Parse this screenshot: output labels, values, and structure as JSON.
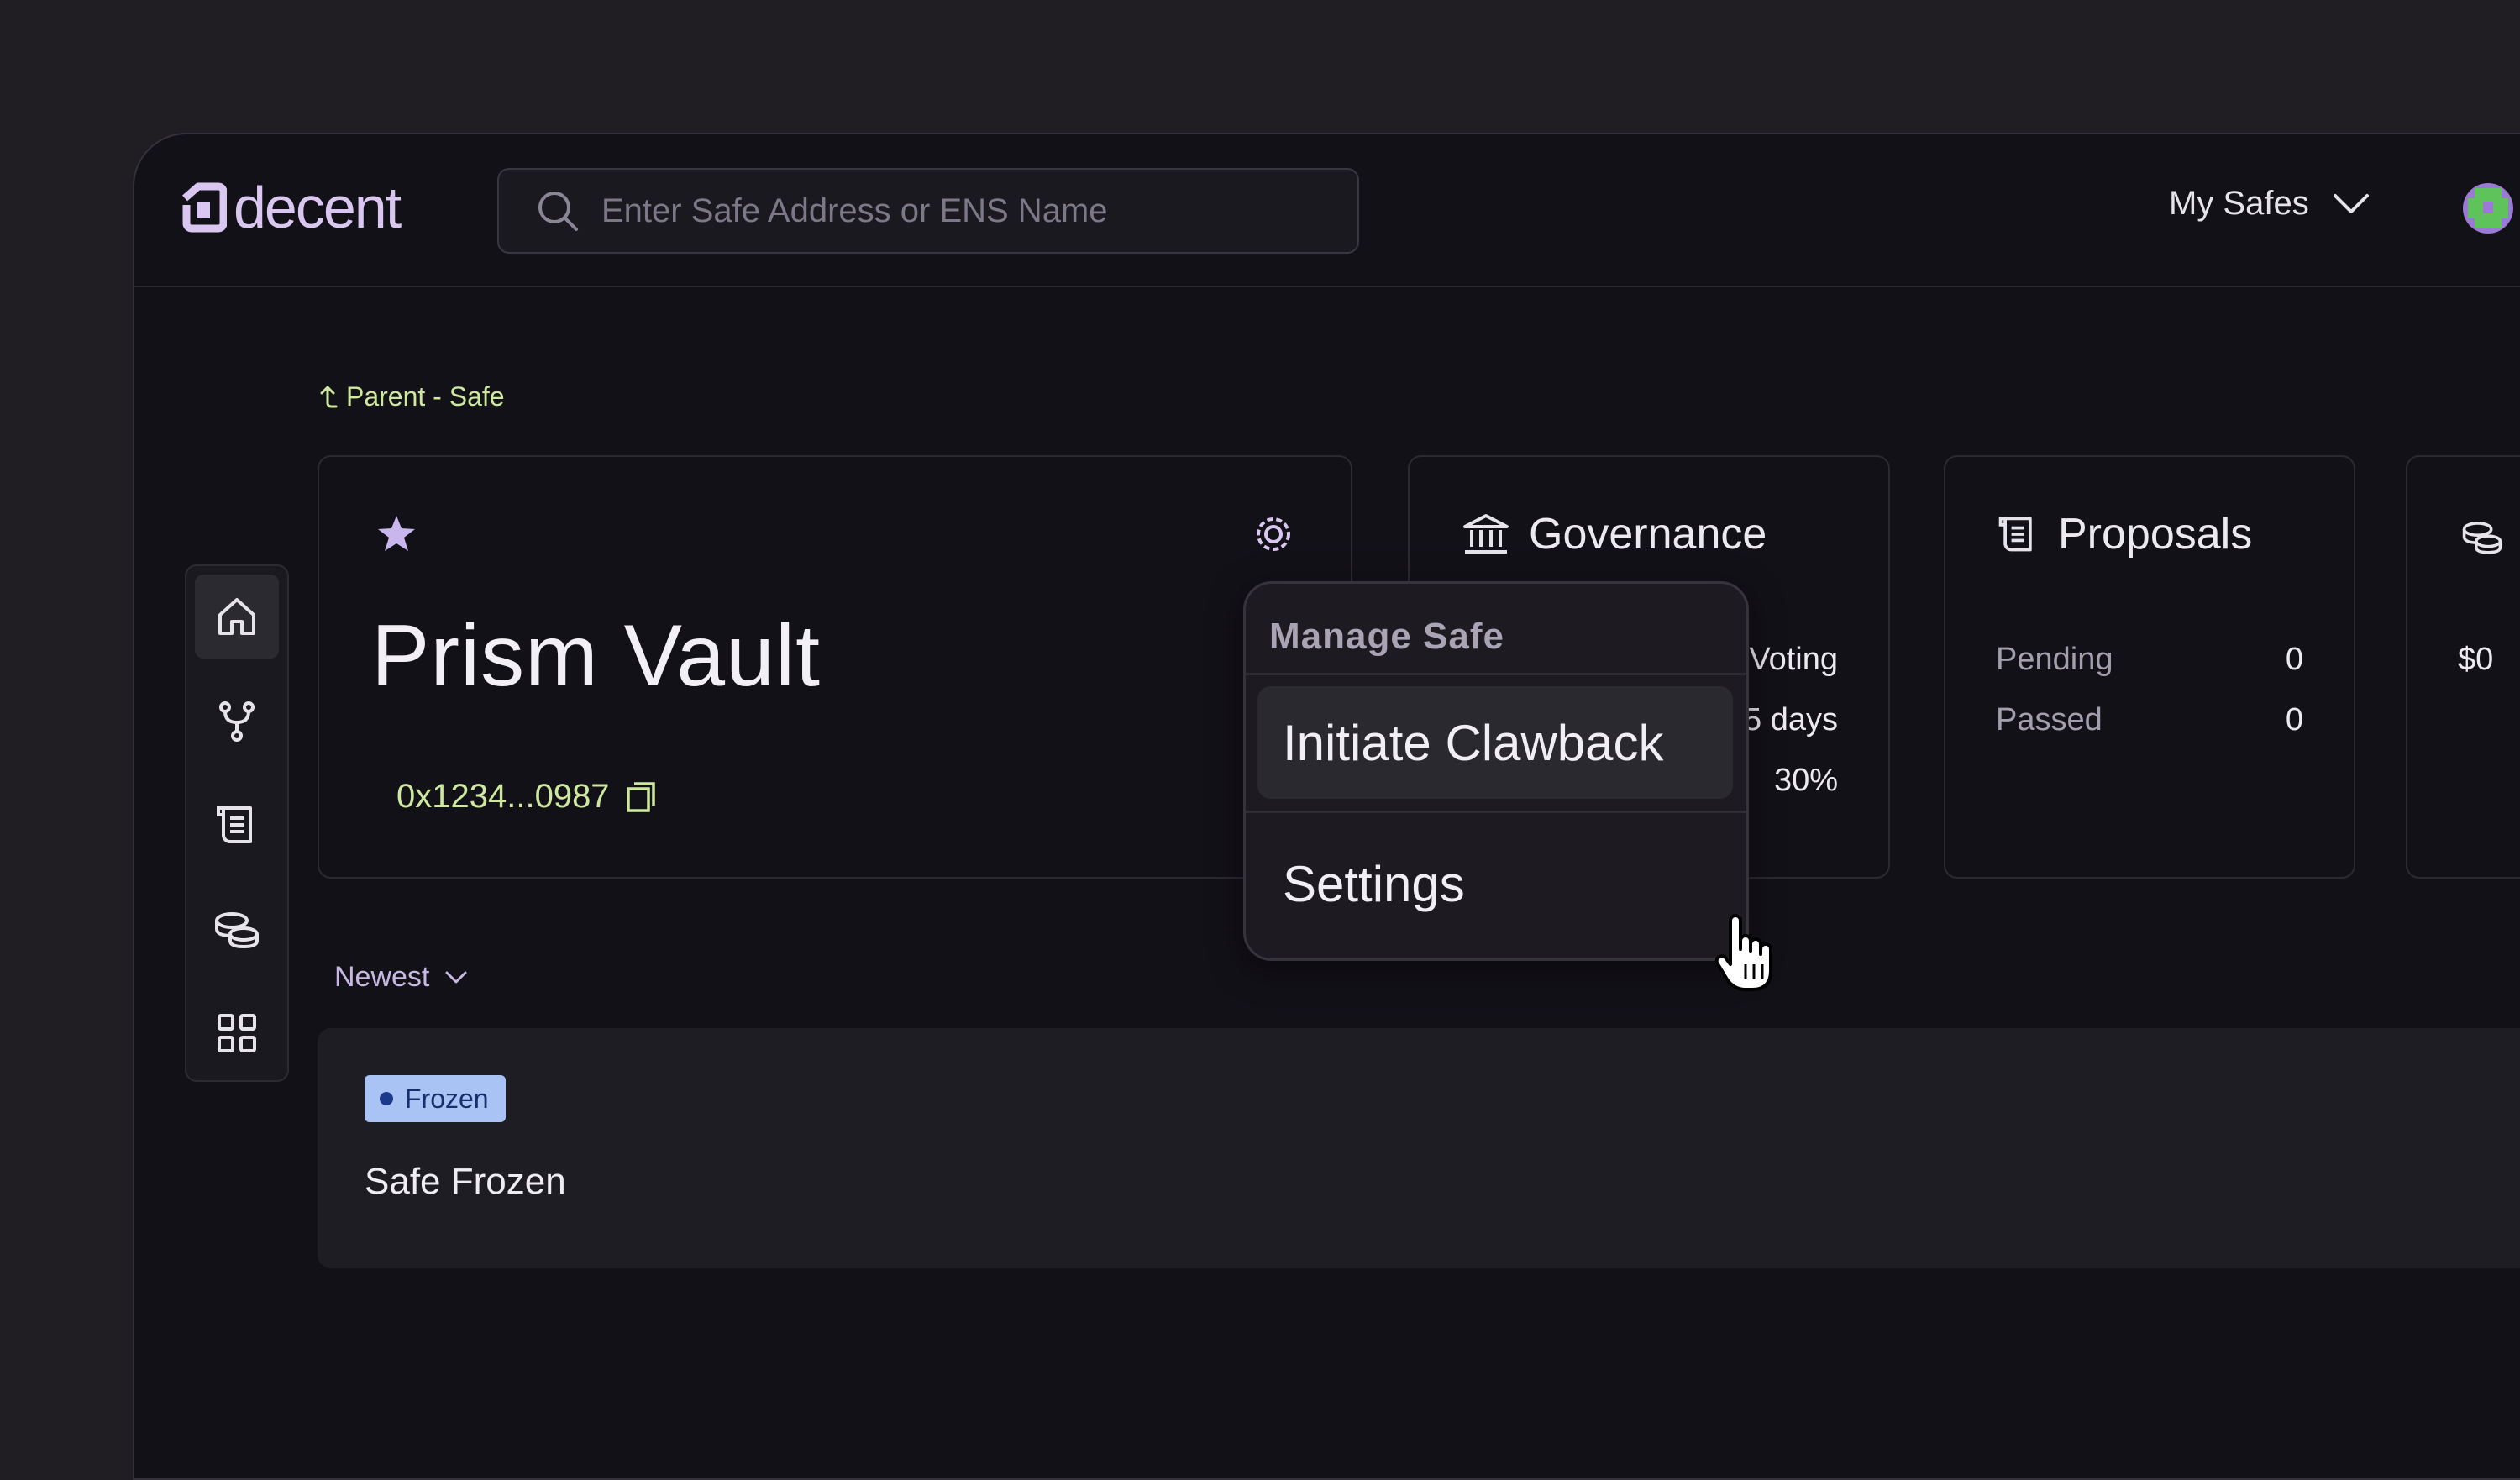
{
  "brand": {
    "name": "decent"
  },
  "search": {
    "placeholder": "Enter Safe Address or ENS Name"
  },
  "header": {
    "my_safes_label": "My Safes"
  },
  "breadcrumb": {
    "label": "Parent - Safe"
  },
  "sidebar": {
    "items": [
      {
        "icon": "home-icon",
        "active": true
      },
      {
        "icon": "hierarchy-icon",
        "active": false
      },
      {
        "icon": "proposals-icon",
        "active": false
      },
      {
        "icon": "treasury-icon",
        "active": false
      },
      {
        "icon": "apps-icon",
        "active": false
      }
    ]
  },
  "dao": {
    "name": "Prism Vault",
    "address": "0x1234...0987"
  },
  "governance": {
    "title": "Governance",
    "rows": [
      {
        "value": "Voting"
      },
      {
        "value": "5 days"
      },
      {
        "value": "30%"
      }
    ]
  },
  "proposals": {
    "title": "Proposals",
    "rows": [
      {
        "label": "Pending",
        "value": "0"
      },
      {
        "label": "Passed",
        "value": "0"
      }
    ]
  },
  "treasury": {
    "value": "$0"
  },
  "manage_menu": {
    "heading": "Manage Safe",
    "items": [
      "Initiate Clawback",
      "Settings"
    ]
  },
  "sort": {
    "label": "Newest"
  },
  "activity": {
    "badge": "Frozen",
    "title": "Safe Frozen"
  },
  "colors": {
    "accent_lilac": "#d9c7f2",
    "accent_green": "#cfe8a0",
    "badge_blue": "#a9c3f5",
    "background": "#131118"
  }
}
